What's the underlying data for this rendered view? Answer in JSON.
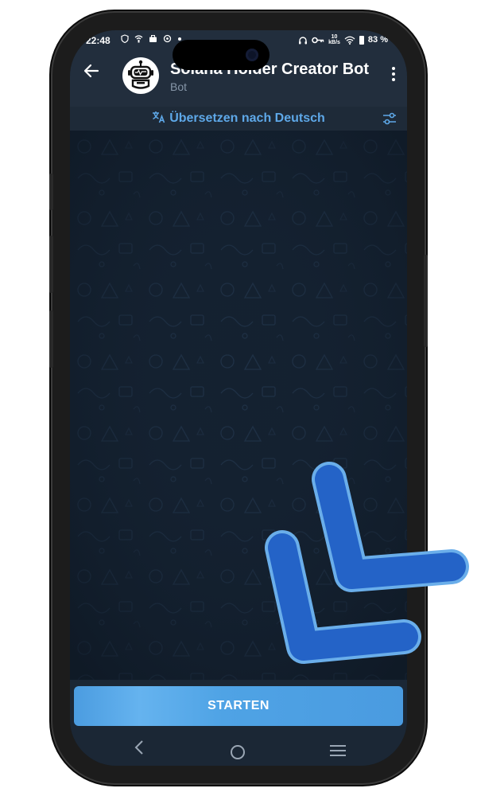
{
  "status_bar": {
    "time": "22:48",
    "left_icons": [
      "shield-icon",
      "network-icon",
      "briefcase-icon",
      "sync-icon",
      "dot-icon"
    ],
    "net_speed_value": "10",
    "net_speed_unit": "kB/s",
    "battery": "83 %",
    "right_icons": [
      "headphones-icon",
      "key-icon",
      "wifi-icon",
      "battery-icon"
    ]
  },
  "header": {
    "title": "Solana Holder Creator Bot",
    "subtitle": "Bot",
    "back_icon": "arrow-left-icon",
    "menu_icon": "more-vertical-icon",
    "avatar_icon": "robot-icon"
  },
  "translate_bar": {
    "label": "Übersetzen nach Deutsch",
    "icon": "translate-icon",
    "settings_icon": "tune-icon"
  },
  "bottom": {
    "start_label": "STARTEN"
  },
  "navbar": {
    "back_icon": "nav-back-icon",
    "home_icon": "nav-home-icon",
    "recents_icon": "nav-recents-icon"
  },
  "colors": {
    "header_bg": "#222e3d",
    "chat_bg": "#142130",
    "accent": "#5ea8e8",
    "button_bg": "#4fa3e5",
    "overlay_arrow": "#2463c7",
    "overlay_arrow_outline": "#6aaeea"
  }
}
